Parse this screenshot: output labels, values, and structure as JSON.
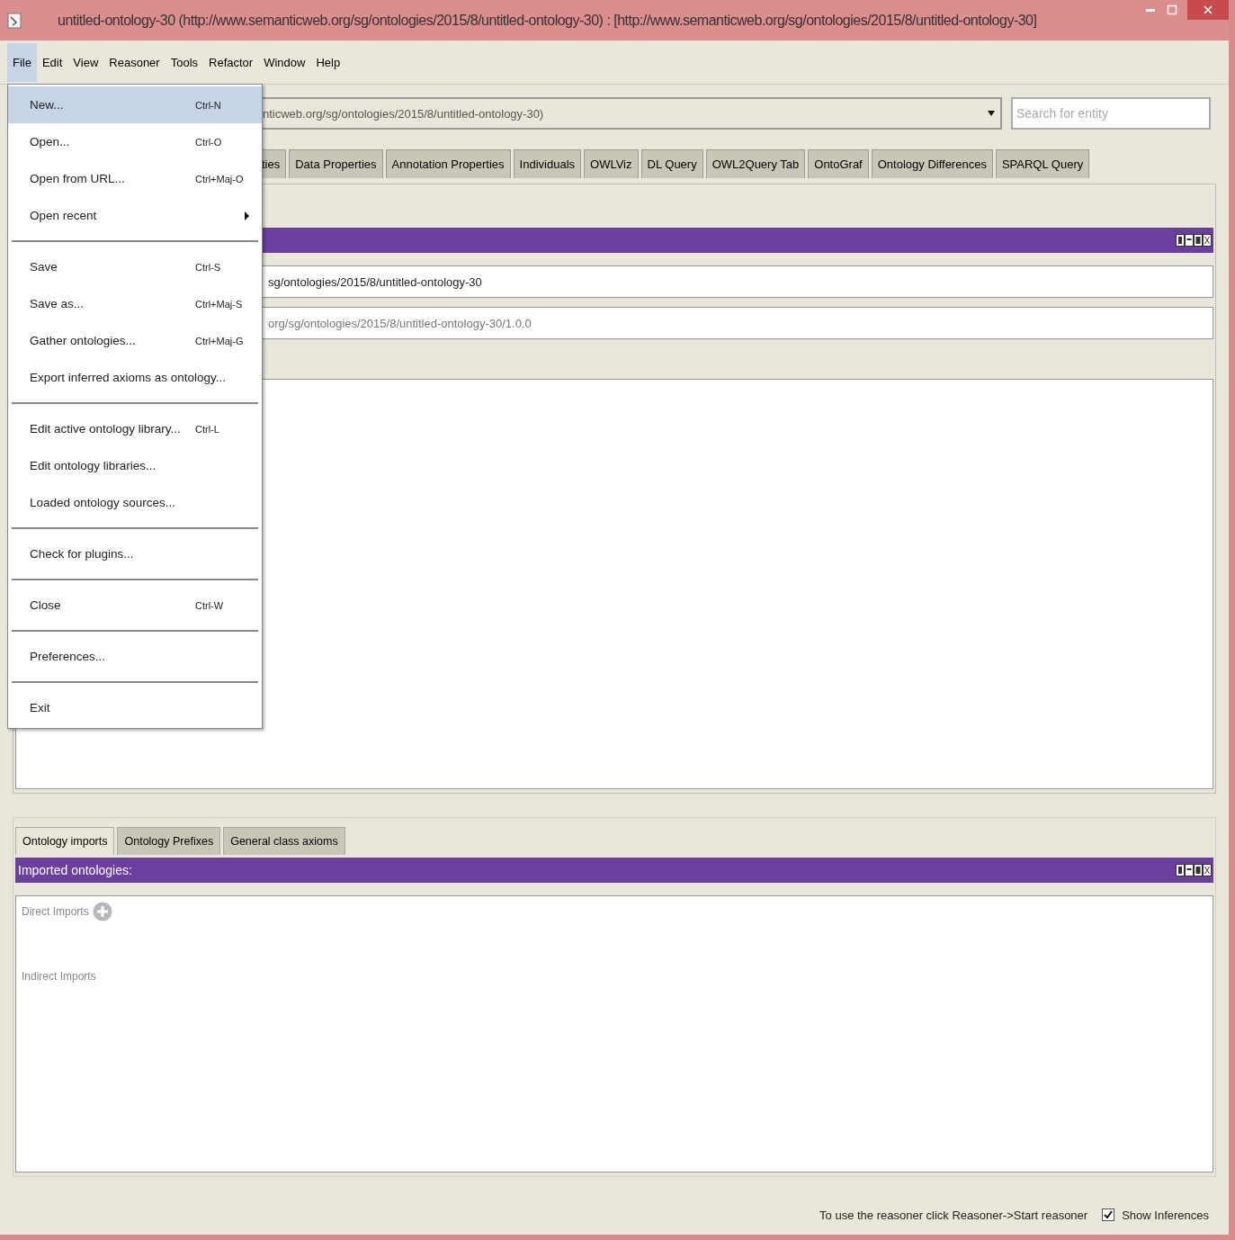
{
  "window": {
    "title": "untitled-ontology-30 (http://www.semanticweb.org/sg/ontologies/2015/8/untitled-ontology-30) : [http://www.semanticweb.org/sg/ontologies/2015/8/untitled-ontology-30]"
  },
  "menubar": [
    {
      "label": "File",
      "selected": true
    },
    {
      "label": "Edit",
      "selected": false
    },
    {
      "label": "View",
      "selected": false
    },
    {
      "label": "Reasoner",
      "selected": false
    },
    {
      "label": "Tools",
      "selected": false
    },
    {
      "label": "Refactor",
      "selected": false
    },
    {
      "label": "Window",
      "selected": false
    },
    {
      "label": "Help",
      "selected": false
    }
  ],
  "file_menu": [
    {
      "kind": "item",
      "label": "New...",
      "shortcut": "Ctrl-N",
      "selected": true
    },
    {
      "kind": "item",
      "label": "Open...",
      "shortcut": "Ctrl-O",
      "selected": false
    },
    {
      "kind": "item",
      "label": "Open from URL...",
      "shortcut": "Ctrl+Maj-O",
      "selected": false
    },
    {
      "kind": "submenu",
      "label": "Open recent",
      "selected": false
    },
    {
      "kind": "separator"
    },
    {
      "kind": "item",
      "label": "Save",
      "shortcut": "Ctrl-S",
      "selected": false
    },
    {
      "kind": "item",
      "label": "Save as...",
      "shortcut": "Ctrl+Maj-S",
      "selected": false
    },
    {
      "kind": "item",
      "label": "Gather ontologies...",
      "shortcut": "Ctrl+Maj-G",
      "selected": false
    },
    {
      "kind": "item",
      "label": "Export inferred axioms as ontology...",
      "selected": false
    },
    {
      "kind": "separator"
    },
    {
      "kind": "item",
      "label": "Edit active ontology library...",
      "shortcut": "Ctrl-L",
      "selected": false
    },
    {
      "kind": "item",
      "label": "Edit ontology libraries...",
      "selected": false
    },
    {
      "kind": "item",
      "label": "Loaded ontology sources...",
      "selected": false
    },
    {
      "kind": "separator"
    },
    {
      "kind": "item",
      "label": "Check for plugins...",
      "selected": false
    },
    {
      "kind": "separator"
    },
    {
      "kind": "item",
      "label": "Close",
      "shortcut": "Ctrl-W",
      "selected": false
    },
    {
      "kind": "separator"
    },
    {
      "kind": "item",
      "label": "Preferences...",
      "selected": false
    },
    {
      "kind": "separator"
    },
    {
      "kind": "item",
      "label": "Exit",
      "selected": false
    }
  ],
  "ontology_selector": {
    "value": "nticweb.org/sg/ontologies/2015/8/untitled-ontology-30)"
  },
  "search": {
    "placeholder": "Search for entity"
  },
  "tabs": [
    {
      "label": "ties",
      "selected": false
    },
    {
      "label": "Data Properties",
      "selected": false
    },
    {
      "label": "Annotation Properties",
      "selected": false
    },
    {
      "label": "Individuals",
      "selected": false
    },
    {
      "label": "OWLViz",
      "selected": false
    },
    {
      "label": "DL Query",
      "selected": false
    },
    {
      "label": "OWL2Query Tab",
      "selected": false
    },
    {
      "label": "OntoGraf",
      "selected": false
    },
    {
      "label": "Ontology Differences",
      "selected": false
    },
    {
      "label": "SPARQL Query",
      "selected": false
    }
  ],
  "header_panel": {
    "ontology_iri": "sg/ontologies/2015/8/untitled-ontology-30",
    "version_iri": "org/sg/ontologies/2015/8/untitled-ontology-30/1.0.0"
  },
  "bottom_tabs": [
    {
      "label": "Ontology imports",
      "selected": true
    },
    {
      "label": "Ontology Prefixes",
      "selected": false
    },
    {
      "label": "General class axioms",
      "selected": false
    }
  ],
  "imports_panel": {
    "title": "Imported ontologies:",
    "direct": "Direct Imports",
    "indirect": "Indirect Imports"
  },
  "status_bar": {
    "message": "To use the reasoner click Reasoner->Start reasoner",
    "show_inferences": {
      "label": "Show Inferences",
      "checked": true
    }
  }
}
